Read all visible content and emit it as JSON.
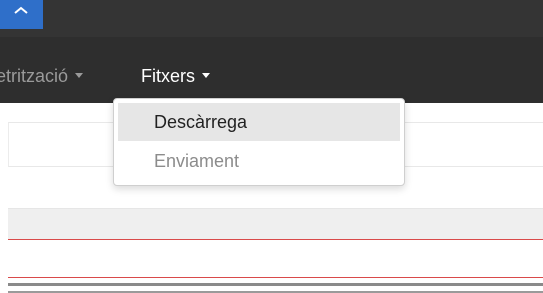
{
  "nav": {
    "partial_item": {
      "label": "etrització",
      "has_caret": true
    },
    "files_menu": {
      "label": "Fitxers",
      "has_caret": true
    }
  },
  "dropdown": {
    "items": [
      {
        "label": "Descàrrega",
        "state": "hover"
      },
      {
        "label": "Enviament",
        "state": "disabled"
      }
    ]
  },
  "colors": {
    "navbar_bg": "#2e2e2e",
    "brand_blue": "#2f6fc9",
    "accent_red": "#d94a4a"
  },
  "icons": {
    "brand": "chevron-icon"
  }
}
